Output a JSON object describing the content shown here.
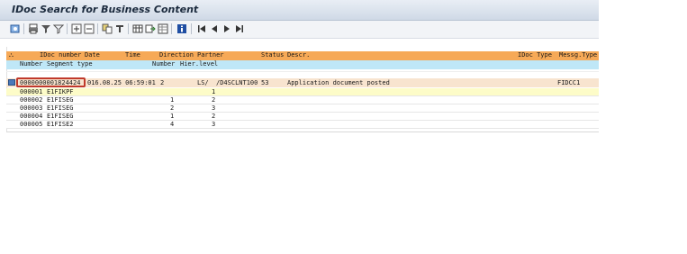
{
  "window": {
    "title": "IDoc Search for Business Content"
  },
  "toolbar": {
    "icons": [
      "refresh-icon",
      "print-icon",
      "filter-icon",
      "filter-alt-icon",
      "expand-icon",
      "collapse-icon",
      "copy-icon",
      "sort-icon",
      "layout-icon",
      "export-icon",
      "spreadsheet-icon",
      "info-icon",
      "first-page-icon",
      "prev-page-icon",
      "next-page-icon",
      "last-page-icon"
    ]
  },
  "table": {
    "header": {
      "icon": "tree-icon",
      "idoc_number": "IDoc number",
      "date": "Date",
      "time": "Time",
      "direction": "Direction",
      "partner": "Partner",
      "status": "Status",
      "descr": "Descr.",
      "idoc_type": "IDoc Type",
      "mesg_type": "Messg.Type"
    },
    "subheader": {
      "number": "Number",
      "segment_type": "Segment type",
      "number2": "Number",
      "hier_level": "Hier.level"
    },
    "idoc": {
      "number": "0000000001824424",
      "date_time": "016.08.25 06:59:01",
      "direction": "2",
      "partner_type": "LS/",
      "partner": "/D4SCLNT100",
      "status": "53",
      "descr": "Application document posted",
      "idoc_type": "FIDCC1"
    },
    "segments": [
      {
        "number": "000001",
        "segment_type": "E1FIKPF",
        "num": "",
        "level": "1"
      },
      {
        "number": "000002",
        "segment_type": "E1FISEG",
        "num": "1",
        "level": "2"
      },
      {
        "number": "000003",
        "segment_type": "E1FISEG",
        "num": "2",
        "level": "3"
      },
      {
        "number": "000004",
        "segment_type": "E1FISEG",
        "num": "1",
        "level": "2"
      },
      {
        "number": "000005",
        "segment_type": "E1FISE2",
        "num": "4",
        "level": "3"
      }
    ]
  },
  "colors": {
    "header_bg": "#f6a957",
    "subheader_bg": "#bfe7f7",
    "highlight_border": "#c0392b"
  }
}
